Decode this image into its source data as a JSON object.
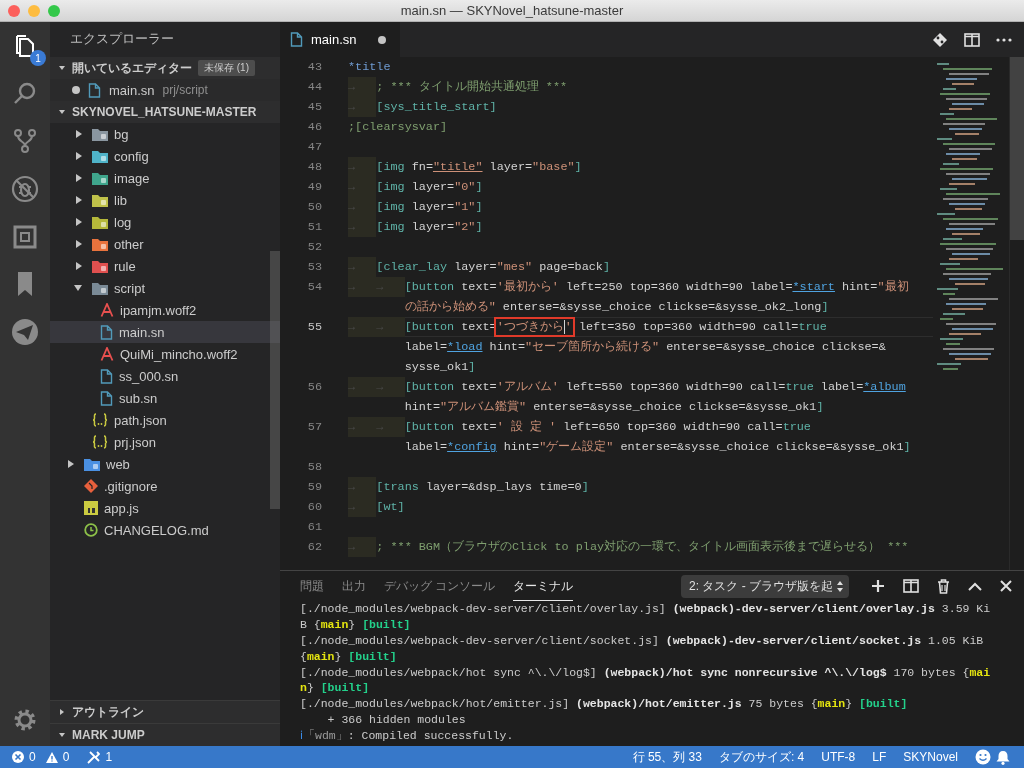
{
  "window": {
    "title": "main.sn — SKYNovel_hatsune-master"
  },
  "activity_bar": {
    "items": [
      {
        "kind": "files",
        "selected": true,
        "badge": "1"
      },
      {
        "kind": "search",
        "selected": false
      },
      {
        "kind": "scm",
        "selected": false
      },
      {
        "kind": "debug",
        "selected": false
      },
      {
        "kind": "extensions",
        "selected": false
      },
      {
        "kind": "bookmarks",
        "selected": false
      },
      {
        "kind": "send",
        "selected": false
      }
    ]
  },
  "sidebar": {
    "title": "エクスプローラー",
    "open_editors": {
      "title": "開いているエディター",
      "expanded": true,
      "badge": "未保存 (1)",
      "items": [
        {
          "name": "main.sn",
          "path": "prj/script",
          "modified": true,
          "selected": false
        }
      ]
    },
    "project": {
      "title": "SKYNOVEL_HATSUNE-MASTER",
      "expanded": true,
      "tree": [
        {
          "kind": "group",
          "children": [
            {
              "name": "bg",
              "kind": "folder",
              "color": "#8a96a0",
              "expanded": false,
              "selected": false
            },
            {
              "name": "config",
              "kind": "folder",
              "color": "#4fb3c8",
              "expanded": false,
              "selected": false
            },
            {
              "name": "image",
              "kind": "folder",
              "color": "#3fa58c",
              "expanded": false,
              "selected": false
            },
            {
              "name": "lib",
              "kind": "folder",
              "color": "#c0c24a",
              "expanded": false,
              "selected": false
            },
            {
              "name": "log",
              "kind": "folder",
              "color": "#b5b83a",
              "expanded": false,
              "selected": false
            },
            {
              "name": "other",
              "kind": "folder",
              "color": "#e8733d",
              "expanded": false,
              "selected": false
            },
            {
              "name": "rule",
              "kind": "folder",
              "color": "#e0504f",
              "expanded": false,
              "selected": false
            },
            {
              "name": "script",
              "kind": "folder",
              "color": "#7a8a96",
              "expanded": true,
              "selected": false,
              "children": [
                {
                  "name": "ipamjm.woff2",
                  "kind": "font",
                  "selected": false
                },
                {
                  "name": "main.sn",
                  "kind": "file",
                  "selected": true
                },
                {
                  "name": "QuiMi_mincho.woff2",
                  "kind": "font",
                  "selected": false
                },
                {
                  "name": "ss_000.sn",
                  "kind": "file",
                  "selected": false
                },
                {
                  "name": "sub.sn",
                  "kind": "file",
                  "selected": false
                }
              ]
            },
            {
              "name": "path.json",
              "kind": "json",
              "selected": false
            },
            {
              "name": "prj.json",
              "kind": "json",
              "selected": false
            }
          ]
        },
        {
          "name": "web",
          "kind": "folder",
          "color": "#4a90e2",
          "expanded": false,
          "selected": false
        },
        {
          "name": ".gitignore",
          "kind": "git",
          "selected": false
        },
        {
          "name": "app.js",
          "kind": "js",
          "selected": false
        },
        {
          "name": "CHANGELOG.md",
          "kind": "changelog",
          "selected": false
        }
      ]
    },
    "outline": {
      "title": "アウトライン",
      "expanded": false
    },
    "mark_jump": {
      "title": "MARK JUMP",
      "expanded": true
    }
  },
  "editor": {
    "tabs": [
      {
        "name": "main.sn",
        "modified": true,
        "selected": true
      }
    ],
    "rows": [
      {
        "number": "43",
        "tokens": [
          {
            "kind": "label",
            "text": "*title"
          }
        ]
      },
      {
        "number": "44",
        "tokens": [
          {
            "kind": "tab",
            "text": "→"
          },
          {
            "kind": "comment",
            "text": "; *** タイトル開始共通処理 ***"
          }
        ]
      },
      {
        "number": "45",
        "tokens": [
          {
            "kind": "tab",
            "text": "→"
          },
          {
            "kind": "tag",
            "text": "[sys_title_start]"
          }
        ]
      },
      {
        "number": "46",
        "tokens": [
          {
            "kind": "comment",
            "text": ";[clearsysvar]"
          }
        ]
      },
      {
        "number": "47"
      },
      {
        "number": "48",
        "tokens": [
          {
            "kind": "tab",
            "text": "→"
          },
          {
            "kind": "tag",
            "text": "[img"
          },
          {
            "kind": "attr",
            "text": " fn="
          },
          {
            "kind": "ustr",
            "text": "\"title\""
          },
          {
            "kind": "attr",
            "text": " layer="
          },
          {
            "kind": "str",
            "text": "\"base\""
          },
          {
            "kind": "tag",
            "text": "]"
          }
        ]
      },
      {
        "number": "49",
        "tokens": [
          {
            "kind": "tab",
            "text": "→"
          },
          {
            "kind": "tag",
            "text": "[img"
          },
          {
            "kind": "attr",
            "text": " layer="
          },
          {
            "kind": "str",
            "text": "\"0\""
          },
          {
            "kind": "tag",
            "text": "]"
          }
        ]
      },
      {
        "number": "50",
        "tokens": [
          {
            "kind": "tab",
            "text": "→"
          },
          {
            "kind": "tag",
            "text": "[img"
          },
          {
            "kind": "attr",
            "text": " layer="
          },
          {
            "kind": "str",
            "text": "\"1\""
          },
          {
            "kind": "tag",
            "text": "]"
          }
        ]
      },
      {
        "number": "51",
        "tokens": [
          {
            "kind": "tab",
            "text": "→"
          },
          {
            "kind": "tag",
            "text": "[img"
          },
          {
            "kind": "attr",
            "text": " layer="
          },
          {
            "kind": "str",
            "text": "\"2\""
          },
          {
            "kind": "tag",
            "text": "]"
          }
        ]
      },
      {
        "number": "52"
      },
      {
        "number": "53",
        "tokens": [
          {
            "kind": "tab",
            "text": "→"
          },
          {
            "kind": "tag",
            "text": "[clear_lay"
          },
          {
            "kind": "attr",
            "text": " layer="
          },
          {
            "kind": "str",
            "text": "\"mes\""
          },
          {
            "kind": "attr",
            "text": " page=back"
          },
          {
            "kind": "tag",
            "text": "]"
          }
        ]
      },
      {
        "number": "54",
        "tokens": [
          {
            "kind": "tab",
            "text": "→"
          },
          {
            "kind": "tab",
            "text": "→"
          },
          {
            "kind": "tag",
            "text": "[button"
          },
          {
            "kind": "attr",
            "text": " text="
          },
          {
            "kind": "str",
            "text": "'最初から'"
          },
          {
            "kind": "attr",
            "text": " left=250 top=360 width=90 label="
          },
          {
            "kind": "link",
            "text": "*start"
          },
          {
            "kind": "attr",
            "text": " hint="
          },
          {
            "kind": "str",
            "text": "\"最初"
          }
        ]
      },
      {
        "tokens": [
          {
            "kind": "str",
            "text": "の話から始める\""
          },
          {
            "kind": "attr",
            "text": " enterse=&sysse_choice clickse=&sysse_ok2_long"
          },
          {
            "kind": "tag",
            "text": "]"
          }
        ]
      },
      {
        "number": "55",
        "current": true,
        "tokens": [
          {
            "kind": "tab",
            "text": "→"
          },
          {
            "kind": "tab",
            "text": "→"
          },
          {
            "kind": "tag",
            "text": "[button"
          },
          {
            "kind": "attr",
            "text": " text="
          },
          {
            "kind": "boxed",
            "text": "'つづきから",
            "tail": "'"
          },
          {
            "kind": "attr",
            "text": " left=350 top=360 width=90 call="
          },
          {
            "kind": "kw",
            "text": "true"
          }
        ]
      },
      {
        "tokens": [
          {
            "kind": "attr",
            "text": "label="
          },
          {
            "kind": "link",
            "text": "*load"
          },
          {
            "kind": "attr",
            "text": " hint="
          },
          {
            "kind": "str",
            "text": "\"セーブ箇所から続ける\""
          },
          {
            "kind": "attr",
            "text": " enterse=&sysse_choice clickse=&"
          }
        ]
      },
      {
        "tokens": [
          {
            "kind": "attr",
            "text": "sysse_ok1"
          },
          {
            "kind": "tag",
            "text": "]"
          }
        ]
      },
      {
        "number": "56",
        "tokens": [
          {
            "kind": "tab",
            "text": "→"
          },
          {
            "kind": "tab",
            "text": "→"
          },
          {
            "kind": "tag",
            "text": "[button"
          },
          {
            "kind": "attr",
            "text": " text="
          },
          {
            "kind": "str",
            "text": "'アルバム'"
          },
          {
            "kind": "attr",
            "text": " left=550 top=360 width=90 call="
          },
          {
            "kind": "kw",
            "text": "true"
          },
          {
            "kind": "attr",
            "text": " label="
          },
          {
            "kind": "link",
            "text": "*album"
          }
        ]
      },
      {
        "tokens": [
          {
            "kind": "attr",
            "text": "hint="
          },
          {
            "kind": "str",
            "text": "\"アルバム鑑賞\""
          },
          {
            "kind": "attr",
            "text": " enterse=&sysse_choice clickse=&sysse_ok1"
          },
          {
            "kind": "tag",
            "text": "]"
          }
        ]
      },
      {
        "number": "57",
        "tokens": [
          {
            "kind": "tab",
            "text": "→"
          },
          {
            "kind": "tab",
            "text": "→"
          },
          {
            "kind": "tag",
            "text": "[button"
          },
          {
            "kind": "attr",
            "text": " text="
          },
          {
            "kind": "str",
            "text": "' 設 定 '"
          },
          {
            "kind": "attr",
            "text": " left=650 top=360 width=90 call="
          },
          {
            "kind": "kw",
            "text": "true"
          }
        ]
      },
      {
        "tokens": [
          {
            "kind": "attr",
            "text": "label="
          },
          {
            "kind": "link",
            "text": "*config"
          },
          {
            "kind": "attr",
            "text": " hint="
          },
          {
            "kind": "str",
            "text": "\"ゲーム設定\""
          },
          {
            "kind": "attr",
            "text": " enterse=&sysse_choice clickse=&sysse_ok1"
          },
          {
            "kind": "tag",
            "text": "]"
          }
        ]
      },
      {
        "number": "58"
      },
      {
        "number": "59",
        "tokens": [
          {
            "kind": "tab",
            "text": "→"
          },
          {
            "kind": "tag",
            "text": "[trans"
          },
          {
            "kind": "attr",
            "text": " layer=&dsp_lays time=0"
          },
          {
            "kind": "tag",
            "text": "]"
          }
        ]
      },
      {
        "number": "60",
        "tokens": [
          {
            "kind": "tab",
            "text": "→"
          },
          {
            "kind": "tag",
            "text": "[wt]"
          }
        ]
      },
      {
        "number": "61"
      },
      {
        "number": "62",
        "tokens": [
          {
            "kind": "tab",
            "text": "→"
          },
          {
            "kind": "comment",
            "text": "; *** BGM（ブラウザのClick to play対応の一環で、タイトル画面表示後まで遅らせる） ***"
          }
        ]
      }
    ]
  },
  "panel": {
    "tabs": [
      {
        "label": "問題",
        "selected": false
      },
      {
        "label": "出力",
        "selected": false
      },
      {
        "label": "デバッグ コンソール",
        "selected": false
      },
      {
        "label": "ターミナル",
        "selected": true
      }
    ],
    "terminal_select": "2: タスク - ブラウザ版を起",
    "lines": [
      {
        "tokens": [
          {
            "kind": "plain",
            "text": "[./node_modules/webpack-dev-server/client/overlay.js] "
          },
          {
            "kind": "bold",
            "text": "(webpack)-dev-server/client/overlay.js"
          },
          {
            "kind": "plain",
            "text": " 3.59 Ki"
          }
        ]
      },
      {
        "tokens": [
          {
            "kind": "plain",
            "text": "B {"
          },
          {
            "kind": "yellow",
            "text": "main"
          },
          {
            "kind": "plain",
            "text": "} "
          },
          {
            "kind": "green",
            "text": "[built]"
          }
        ]
      },
      {
        "tokens": [
          {
            "kind": "plain",
            "text": "[./node_modules/webpack-dev-server/client/socket.js] "
          },
          {
            "kind": "bold",
            "text": "(webpack)-dev-server/client/socket.js"
          },
          {
            "kind": "plain",
            "text": " 1.05 KiB"
          }
        ]
      },
      {
        "tokens": [
          {
            "kind": "plain",
            "text": "{"
          },
          {
            "kind": "yellow",
            "text": "main"
          },
          {
            "kind": "plain",
            "text": "} "
          },
          {
            "kind": "green",
            "text": "[built]"
          }
        ]
      },
      {
        "tokens": [
          {
            "kind": "plain",
            "text": "[./node_modules/webpack/hot sync ^\\.\\/log$] "
          },
          {
            "kind": "bold",
            "text": "(webpack)/hot sync nonrecursive ^\\.\\/log$"
          },
          {
            "kind": "plain",
            "text": " 170 bytes {"
          },
          {
            "kind": "yellow",
            "text": "mai"
          }
        ]
      },
      {
        "tokens": [
          {
            "kind": "yellow",
            "text": "n"
          },
          {
            "kind": "plain",
            "text": "} "
          },
          {
            "kind": "green",
            "text": "[built]"
          }
        ]
      },
      {
        "tokens": [
          {
            "kind": "plain",
            "text": "[./node_modules/webpack/hot/emitter.js] "
          },
          {
            "kind": "bold",
            "text": "(webpack)/hot/emitter.js"
          },
          {
            "kind": "plain",
            "text": " 75 bytes {"
          },
          {
            "kind": "yellow",
            "text": "main"
          },
          {
            "kind": "plain",
            "text": "} "
          },
          {
            "kind": "green",
            "text": "[built]"
          }
        ]
      },
      {
        "tokens": [
          {
            "kind": "plain",
            "text": "    + 366 hidden modules"
          }
        ]
      },
      {
        "tokens": [
          {
            "kind": "info",
            "text": "ℹ"
          },
          {
            "kind": "dim",
            "text": "「wdm」"
          },
          {
            "kind": "plain",
            "text": ": Compiled successfully."
          }
        ]
      }
    ]
  },
  "status_bar": {
    "errors": "0",
    "warnings": "0",
    "tasks": "1",
    "items": [
      "行 55、列 33",
      "タブのサイズ: 4",
      "UTF-8",
      "LF",
      "SKYNovel"
    ]
  }
}
